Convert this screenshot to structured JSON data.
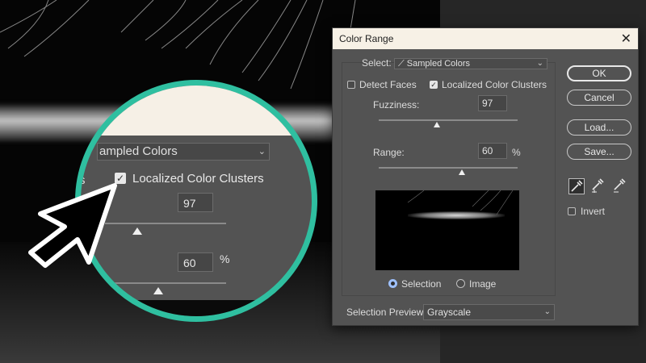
{
  "dialog": {
    "title": "Color Range",
    "close_glyph": "✕",
    "select_label": "Select:",
    "select_value": "Sampled Colors",
    "detect_faces_label": "Detect Faces",
    "detect_faces_checked": false,
    "localized_label": "Localized Color Clusters",
    "localized_checked": true,
    "fuzziness_label": "Fuzziness:",
    "fuzziness_value": "97",
    "fuzziness_fraction": 0.42,
    "range_label": "Range:",
    "range_value": "60",
    "range_unit": "%",
    "range_fraction": 0.6,
    "radio_selection": "Selection",
    "radio_image": "Image",
    "selected_view": "Selection",
    "preview_label": "Selection Preview:",
    "preview_value": "Grayscale",
    "buttons": {
      "ok": "OK",
      "cancel": "Cancel",
      "load": "Load...",
      "save": "Save..."
    },
    "invert_label": "Invert",
    "invert_checked": false,
    "icons": [
      "eyedropper-icon",
      "eyedropper-plus-icon",
      "eyedropper-minus-icon"
    ]
  },
  "magnifier": {
    "select_text": "ampled Colors",
    "partial_label": "s",
    "localized_label": "Localized Color Clusters",
    "fuzziness_value": "97",
    "range_value": "60",
    "range_unit": "%"
  },
  "colors": {
    "accent_ring": "#2fbfa0",
    "dialog_bg": "#535353",
    "titlebar_bg": "#f7f1e6",
    "radio_accent": "#9ec1ff"
  }
}
